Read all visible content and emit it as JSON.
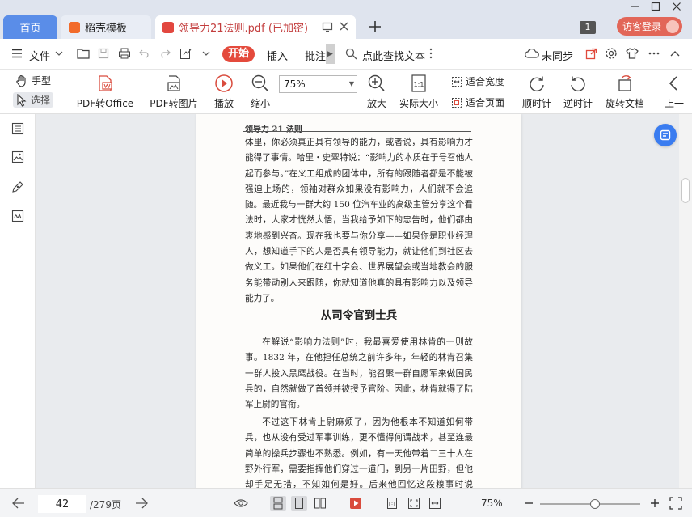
{
  "tabs": {
    "home": "首页",
    "doc1": "稻壳模板",
    "doc2": "领导力21法则.pdf (已加密)",
    "badge": "1",
    "login": "访客登录"
  },
  "menu": {
    "file": "文件",
    "start": "开始",
    "insert": "插入",
    "annotate": "批注",
    "search": "点此查找文本",
    "sync": "未同步"
  },
  "toolbar": {
    "hand": "手型",
    "select": "选择",
    "pdf_to_office": "PDF转Office",
    "pdf_to_image": "PDF转图片",
    "play": "播放",
    "zoom_out": "缩小",
    "zoom_value": "75%",
    "zoom_in": "放大",
    "actual_size": "实际大小",
    "actual_size_icon": "1:1",
    "fit_width": "适合宽度",
    "fit_page": "适合页面",
    "rotate_cw": "顺时针",
    "rotate_ccw": "逆时针",
    "rotate_doc": "旋转文档",
    "prev": "上一"
  },
  "document": {
    "running_head": "领导力 21 法则",
    "para1": "体里，你必须真正具有领导的能力，或者说，具有影响力才能得了事情。哈里・史翠特说：“影响力的本质在于号召他人起而参与。”在义工组成的团体中，所有的跟随者都是不能被强迫上场的，领袖对群众如果没有影响力，人们就不会追随。最近我与一群大约 150 位汽车业的高级主管分享这个看法时，大家才恍然大悟，当我给予如下的忠告时，他们都由衷地感到兴奋。现在我也要与你分享——如果你是职业经理人，想知道手下的人是否具有领导能力，就让他们到社区去做义工。如果他们在红十字会、世界展望会或当地教会的服务能带动别人来跟随，你就知道他真的具有影响力以及领导能力了。",
    "section_title": "从司令官到士兵",
    "para2": "在解说“影响力法则”时，我最喜爱使用林肯的一则故事。1832 年，在他担任总统之前许多年，年轻的林肯召集一群人投入黑鹰战役。在当时，能召聚一群自愿军来做国民兵的，自然就做了首领并被授予官阶。因此，林肯就得了陆军上尉的官衔。",
    "para3": "不过这下林肯上尉麻烦了，因为他根本不知道如何带兵，也从没有受过军事训练，更不懂得何谓战术，甚至连最简单的操兵步骤也不熟悉。例如，有一天他带着二三十人在野外行军，需要指挥他们穿过一道门，到另一片田野，但他却手足无措，不知如何是好。后来他回忆这段糗事时说道：“我活了这辈"
  },
  "status": {
    "page_current": "42",
    "page_total": "/279页",
    "zoom": "75%",
    "zoom_fraction": 0.55
  }
}
